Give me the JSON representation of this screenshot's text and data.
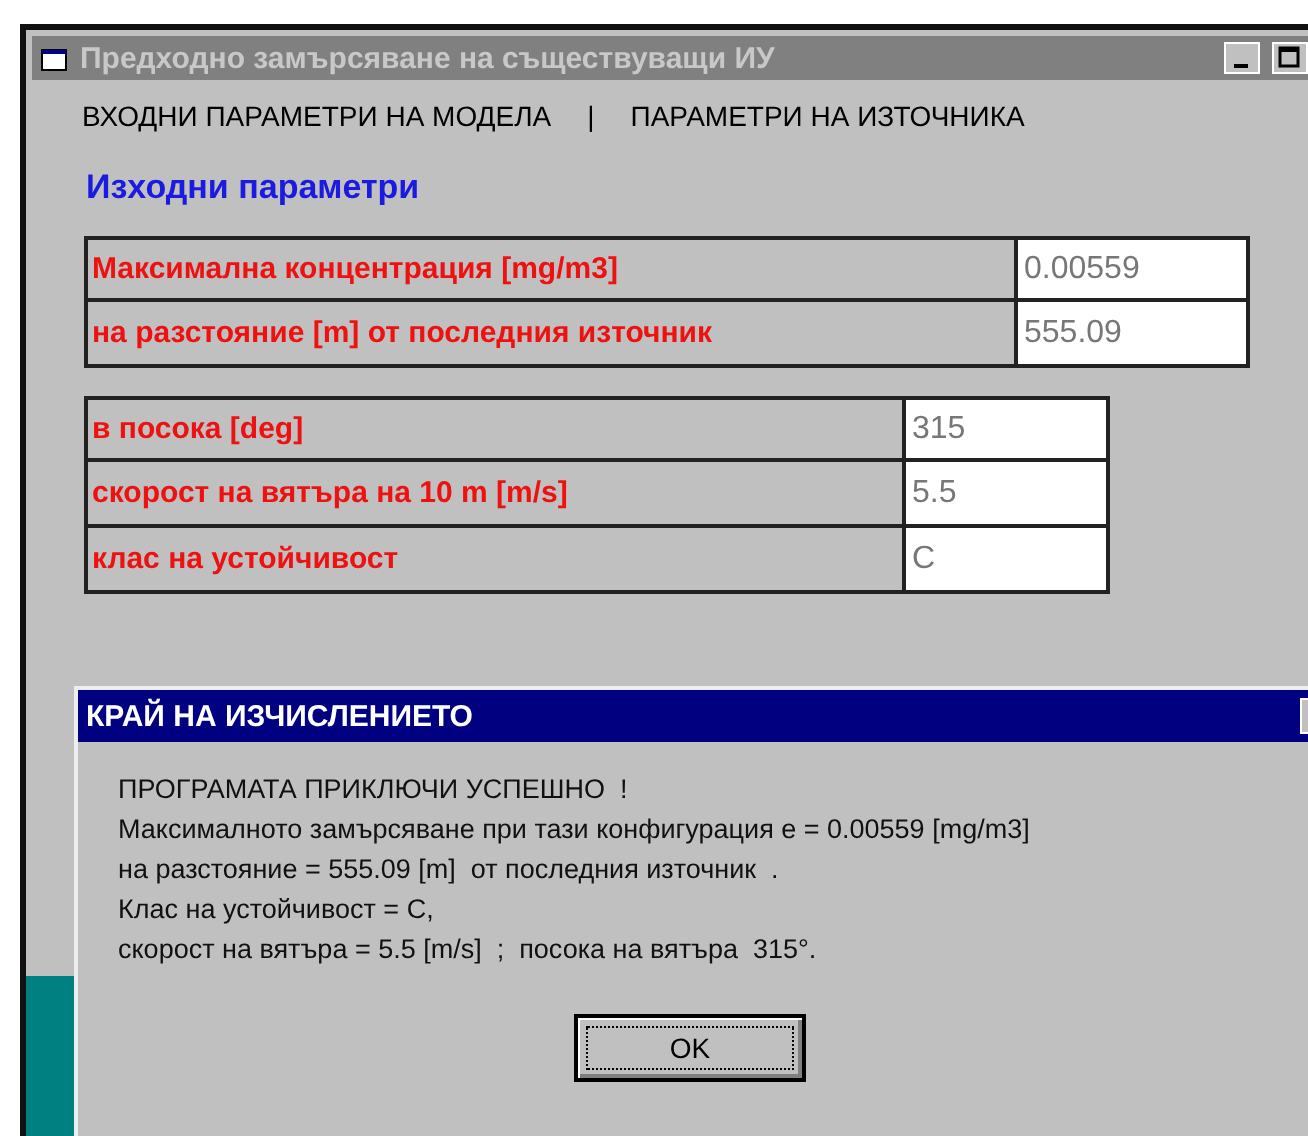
{
  "window": {
    "title": "Предходно замърсяване на съществуващи ИУ"
  },
  "menu": [
    "ВХОДНИ ПАРАМЕТРИ НА МОДЕЛА",
    "|",
    "ПАРАМЕТРИ НА ИЗТОЧНИКА"
  ],
  "heading": "Изходни параметри",
  "results": [
    {
      "label": "Максимална концентрация  [mg/m3]",
      "value": "0.00559"
    },
    {
      "label": "на разстояние [m] от последния източник",
      "value": "555.09"
    }
  ],
  "conditions": [
    {
      "label": "в посока [deg]",
      "value": "315"
    },
    {
      "label": "скорост на вятъра на 10 m [m/s]",
      "value": "5.5"
    },
    {
      "label": "клас на устойчивост",
      "value": "C"
    }
  ],
  "dialog": {
    "title": "КРАЙ НА ИЗЧИСЛЕНИЕТО",
    "lines": [
      "ПРОГРАМАТА ПРИКЛЮЧИ УСПЕШНО  !",
      "Максималното замърсяване при тази конфигурация е = 0.00559 [mg/m3]",
      "на разстояние = 555.09 [m]  от последния източник  .",
      "Клас на устойчивост = C,",
      "скорост на вятъра = 5.5 [m/s]  ;  посока на вятъра  315°."
    ],
    "button": "OK"
  }
}
